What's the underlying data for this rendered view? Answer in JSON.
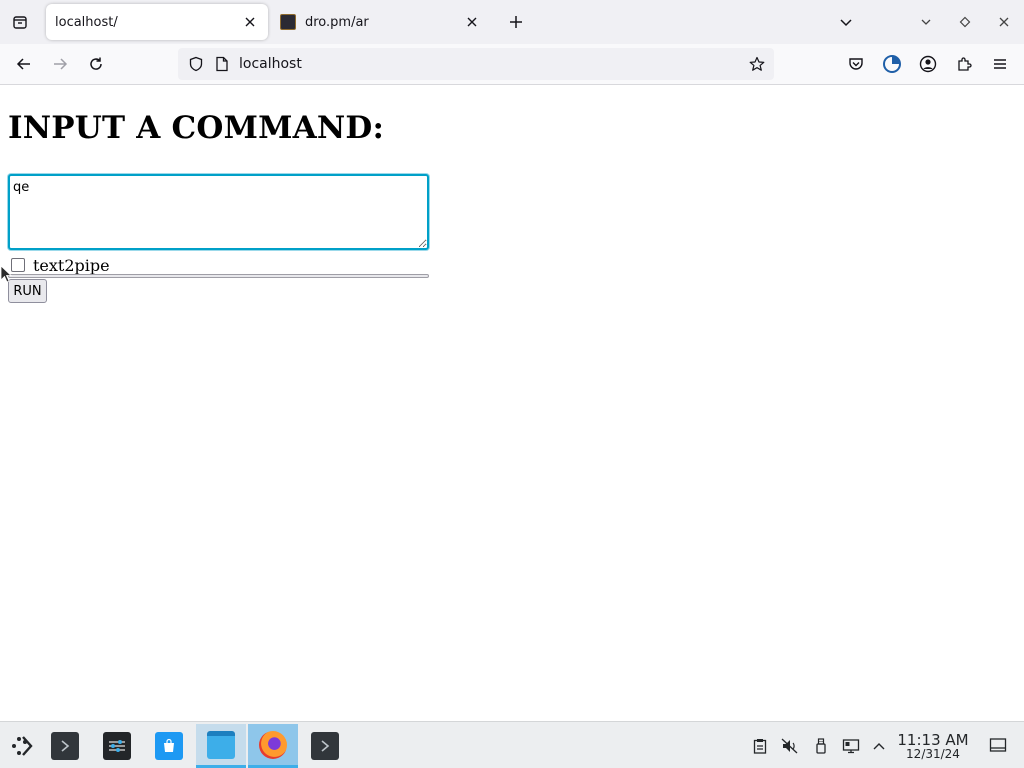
{
  "browser": {
    "tabs": [
      {
        "label": "localhost/",
        "active": true
      },
      {
        "label": "dro.pm/ar",
        "active": false
      }
    ],
    "url": "localhost"
  },
  "page": {
    "heading": "INPUT A COMMAND:",
    "command_value": "qe",
    "checkbox_label": "text2pipe",
    "checkbox_checked": false,
    "run_label": "RUN"
  },
  "taskbar": {
    "apps": [
      "terminal",
      "settings",
      "discover",
      "files",
      "firefox",
      "terminal-2"
    ],
    "clock": {
      "time": "11:13 AM",
      "date": "12/31/24"
    }
  },
  "colors": {
    "focus_accent": "#00a0c8",
    "taskbar_active": "#3daee9"
  }
}
